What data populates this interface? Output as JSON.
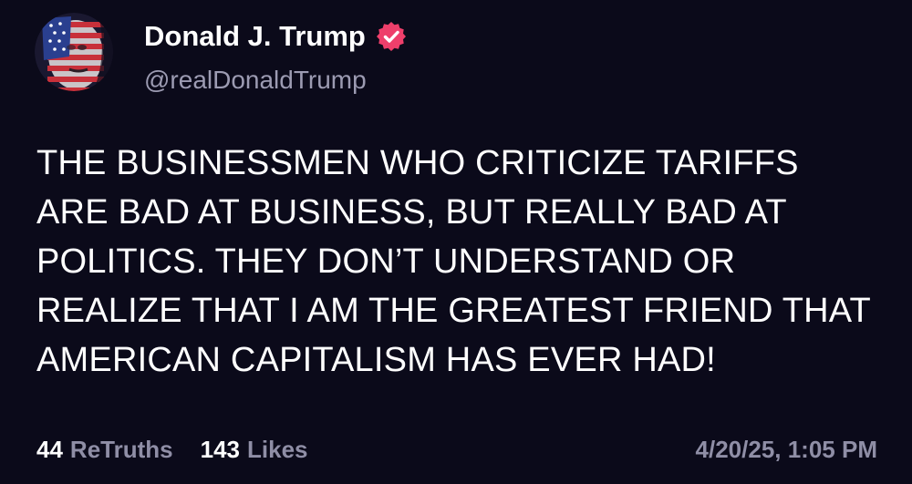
{
  "author": {
    "display_name": "Donald J. Trump",
    "handle": "@realDonaldTrump",
    "verified_icon": "verified-badge-icon",
    "verified_color": "#ee3f6b",
    "avatar_icon": "avatar-flag-face"
  },
  "post": {
    "text": "THE BUSINESSMEN WHO CRITICIZE TARIFFS ARE BAD AT BUSINESS, BUT REALLY BAD AT POLITICS. THEY DON’T UNDERSTAND OR REALIZE THAT I AM THE GREATEST FRIEND THAT AMERICAN CAPITALISM HAS EVER HAD!"
  },
  "stats": {
    "retruths_count": "44",
    "retruths_label": "ReTruths",
    "likes_count": "143",
    "likes_label": "Likes"
  },
  "timestamp": "4/20/25, 1:05 PM",
  "colors": {
    "background": "#0b0a1a",
    "muted_text": "#8f8ea6",
    "primary_text": "#ffffff"
  }
}
